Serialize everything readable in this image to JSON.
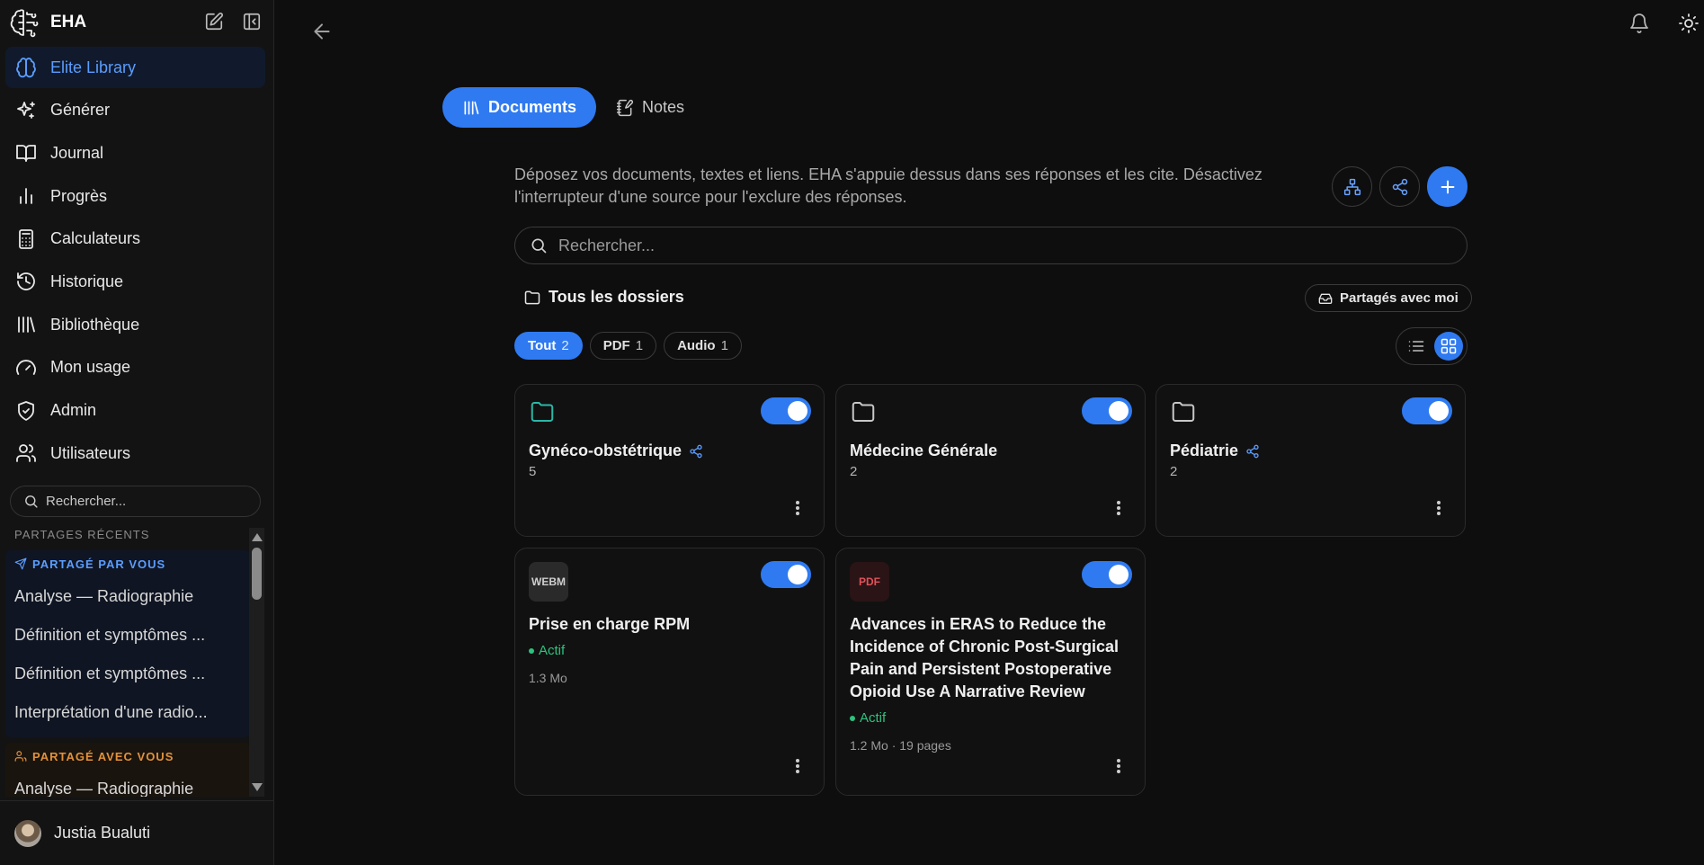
{
  "brand": {
    "name": "EHA"
  },
  "sidebar": {
    "items": [
      {
        "label": "Elite Library",
        "icon": "brain-icon",
        "active": true
      },
      {
        "label": "Générer",
        "icon": "sparkles-icon"
      },
      {
        "label": "Journal",
        "icon": "book-open-icon"
      },
      {
        "label": "Progrès",
        "icon": "bar-chart-icon"
      },
      {
        "label": "Calculateurs",
        "icon": "calculator-icon"
      },
      {
        "label": "Historique",
        "icon": "history-icon"
      },
      {
        "label": "Bibliothèque",
        "icon": "library-icon"
      },
      {
        "label": "Mon usage",
        "icon": "gauge-icon"
      },
      {
        "label": "Admin",
        "icon": "shield-check-icon"
      },
      {
        "label": "Utilisateurs",
        "icon": "users-icon"
      }
    ],
    "search_placeholder": "Rechercher...",
    "recent_title": "PARTAGES RÉCENTS",
    "shared_by_you": {
      "title": "PARTAGÉ PAR VOUS",
      "items": [
        "Analyse — Radiographie",
        "Définition et symptômes ...",
        "Définition et symptômes ...",
        "Interprétation d'une radio..."
      ]
    },
    "shared_with_you": {
      "title": "PARTAGÉ AVEC VOUS",
      "items": [
        "Analyse — Radiographie"
      ]
    },
    "user": {
      "name": "Justia Bualuti"
    }
  },
  "main": {
    "tabs": [
      {
        "label": "Documents",
        "icon": "library-icon",
        "active": true
      },
      {
        "label": "Notes",
        "icon": "notebook-pen-icon",
        "active": false
      }
    ],
    "intro": "Déposez vos documents, textes et liens. EHA s'appuie dessus dans ses réponses et les cite. Désactivez l'interrupteur d'une source pour l'exclure des réponses.",
    "search_placeholder": "Rechercher...",
    "folders_label": "Tous les dossiers",
    "shared_with_me": "Partagés avec moi",
    "filters": [
      {
        "label": "Tout",
        "count": "2",
        "active": true
      },
      {
        "label": "PDF",
        "count": "1",
        "active": false
      },
      {
        "label": "Audio",
        "count": "1",
        "active": false
      }
    ],
    "view_mode": "grid",
    "folders": [
      {
        "name": "Gynéco-obstétrique",
        "count": "5",
        "shared": true,
        "enabled": true,
        "icon_color": "#2bb7a6"
      },
      {
        "name": "Médecine Générale",
        "count": "2",
        "shared": false,
        "enabled": true,
        "icon_color": "#c8c8c8"
      },
      {
        "name": "Pédiatrie",
        "count": "2",
        "shared": true,
        "enabled": true,
        "icon_color": "#c8c8c8"
      }
    ],
    "files": [
      {
        "badge": "WEBM",
        "title": "Prise en charge RPM",
        "status": "Actif",
        "meta": "1.3 Mo",
        "enabled": true,
        "badge_bg": "#2a2a2a",
        "badge_color": "#cfcfcf"
      },
      {
        "badge": "PDF",
        "title": "Advances in ERAS to Reduce the Incidence of Chronic Post-Surgical Pain and Persistent Postoperative Opioid Use A Narrative Review",
        "status": "Actif",
        "meta": "1.2 Mo · 19 pages",
        "enabled": true,
        "badge_bg": "#2a1416",
        "badge_color": "#e0525a"
      }
    ]
  },
  "colors": {
    "accent": "#2f7af0",
    "active_status": "#2ec27e",
    "shared_by_you": "#5b9dff",
    "shared_with_you": "#e3913a"
  }
}
